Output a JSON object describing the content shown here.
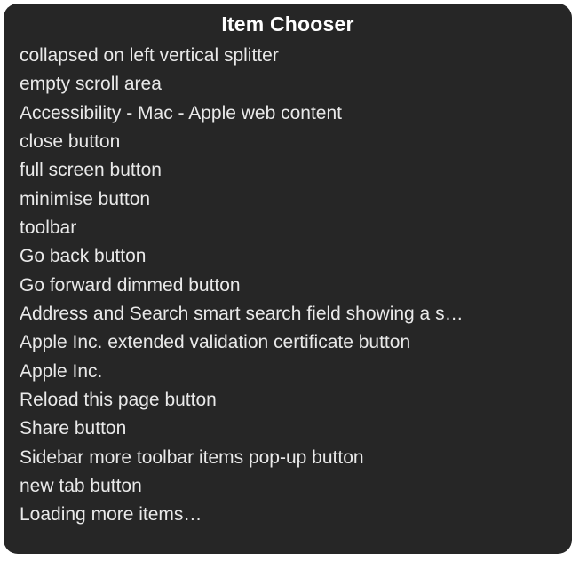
{
  "panel": {
    "title": "Item Chooser",
    "items": [
      "collapsed on left vertical splitter",
      "empty scroll area",
      "Accessibility - Mac - Apple web content",
      "close button",
      "full screen button",
      "minimise button",
      "toolbar",
      "Go back button",
      "Go forward dimmed button",
      "Address and Search smart search field showing a s…",
      "Apple Inc. extended validation certificate button",
      "Apple Inc.",
      "Reload this page button",
      "Share button",
      "Sidebar more toolbar items pop-up button",
      "new tab button",
      "Loading more items…"
    ]
  }
}
